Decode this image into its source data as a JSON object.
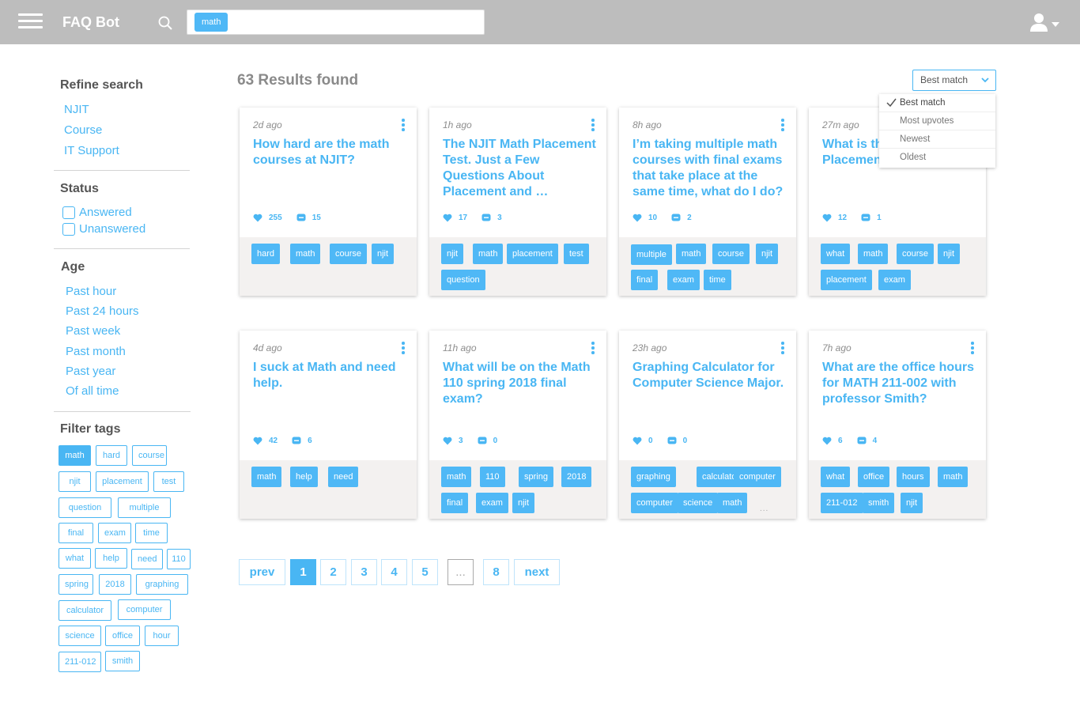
{
  "header": {
    "brand": "FAQ Bot",
    "search_chip": "math"
  },
  "sidebar": {
    "refine_title": "Refine search",
    "refine_links": [
      "NJIT",
      "Course",
      "IT Support"
    ],
    "status_title": "Status",
    "status_options": [
      "Answered",
      "Unanswered"
    ],
    "age_title": "Age",
    "age_options": [
      "Past hour",
      "Past 24 hours",
      "Past week",
      "Past month",
      "Past year",
      "Of all time"
    ],
    "filter_title": "Filter tags",
    "filter_tags": [
      "math",
      "hard",
      "course",
      "njit",
      "placement",
      "test",
      "question",
      "multiple",
      "final",
      "exam",
      "time",
      "what",
      "help",
      "need",
      "110",
      "spring",
      "2018",
      "graphing",
      "calculator",
      "computer",
      "science",
      "office",
      "hour",
      "211-012",
      "smith"
    ],
    "active_tag": "math"
  },
  "results": {
    "title": "63 Results found",
    "sort_selected": "Best match",
    "sort_options": [
      "Best match",
      "Most upvotes",
      "Newest",
      "Oldest"
    ]
  },
  "cards": [
    {
      "time": "2d ago",
      "title": "How hard are the math courses at NJIT?",
      "likes": "255",
      "comments": "15",
      "tags": [
        "hard",
        "math",
        "course",
        "njit"
      ]
    },
    {
      "time": "1h ago",
      "title": "The NJIT Math Placement Test. Just a Few Questions About Placement and …",
      "likes": "17",
      "comments": "3",
      "tags": [
        "njit",
        "math",
        "placement",
        "test",
        "question"
      ]
    },
    {
      "time": "8h ago",
      "title": "I’m taking multiple math courses with final exams that take place at the same time, what do I do?",
      "likes": "10",
      "comments": "2",
      "tags": [
        "multiple",
        "math",
        "course",
        "njit",
        "final",
        "exam",
        "time"
      ]
    },
    {
      "time": "27m ago",
      "title": "What is th Placemen",
      "likes": "12",
      "comments": "1",
      "tags": [
        "what",
        "math",
        "course",
        "njit",
        "placement",
        "exam"
      ]
    },
    {
      "time": "4d ago",
      "title": "I suck at Math and need help.",
      "likes": "42",
      "comments": "6",
      "tags": [
        "math",
        "help",
        "need"
      ]
    },
    {
      "time": "11h ago",
      "title": "What will be on the Math 110 spring 2018 final exam?",
      "likes": "3",
      "comments": "0",
      "tags": [
        "math",
        "110",
        "spring",
        "2018",
        "final",
        "exam",
        "njit"
      ]
    },
    {
      "time": "23h ago",
      "title": "Graphing Calculator for Computer Science Major.",
      "likes": "0",
      "comments": "0",
      "tags": [
        "graphing",
        "calculator",
        "computer",
        "computer",
        "science",
        "math"
      ],
      "more": "..."
    },
    {
      "time": "7h ago",
      "title": "What are the office hours for MATH 211-002 with professor Smith?",
      "likes": "6",
      "comments": "4",
      "tags": [
        "what",
        "office",
        "hours",
        "math",
        "211-012",
        "smith",
        "njit"
      ]
    }
  ],
  "pagination": {
    "prev": "prev",
    "pages": [
      "1",
      "2",
      "3",
      "4",
      "5",
      "...",
      "8"
    ],
    "current": "1",
    "next": "next"
  },
  "colors": {
    "accent": "#49b6f3",
    "header_bg": "#bdbdbd",
    "tag_bg": "#4fb8f6"
  }
}
